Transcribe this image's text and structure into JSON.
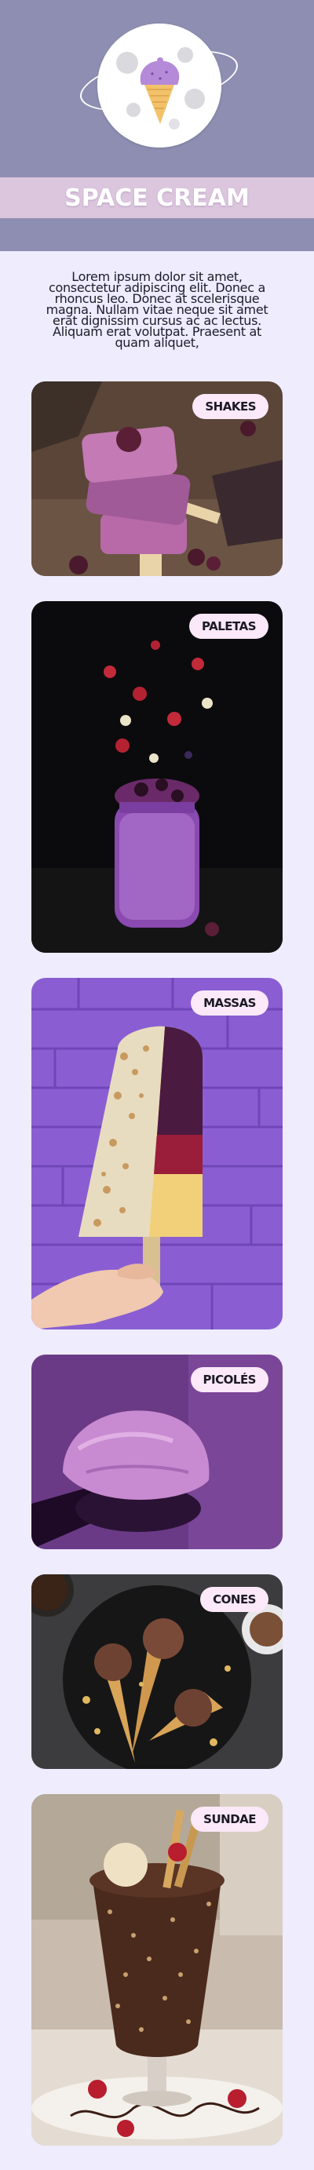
{
  "brand": {
    "title": "SPACE CREAM",
    "logo": "ice-cream-planet-logo"
  },
  "intro": {
    "text": "Lorem ipsum dolor sit amet, consectetur adipiscing elit. Donec a rhoncus leo. Donec at scelerisque magna. Nullam vitae neque sit amet erat dignissim cursus ac ac lectus. Aliquam erat volutpat. Praesent at quam aliquet,"
  },
  "categories": [
    {
      "label": "SHAKES",
      "image": "purple-popsicles-with-blackberries"
    },
    {
      "label": "PALETAS",
      "image": "berry-milkshake-jar-with-falling-fruit"
    },
    {
      "label": "MASSAS",
      "image": "hand-holding-nut-coated-popsicle"
    },
    {
      "label": "PICOLÉS",
      "image": "scoop-of-purple-ice-cream"
    },
    {
      "label": "CONES",
      "image": "chocolate-ice-cream-cones-on-plate"
    },
    {
      "label": "SUNDAE",
      "image": "chocolate-sundae-glass-with-wafers"
    }
  ],
  "colors": {
    "header": "#8e8eb2",
    "title_band": "#dcc6de",
    "page_background": "#eeecfd",
    "badge": "#fbe8f8"
  }
}
